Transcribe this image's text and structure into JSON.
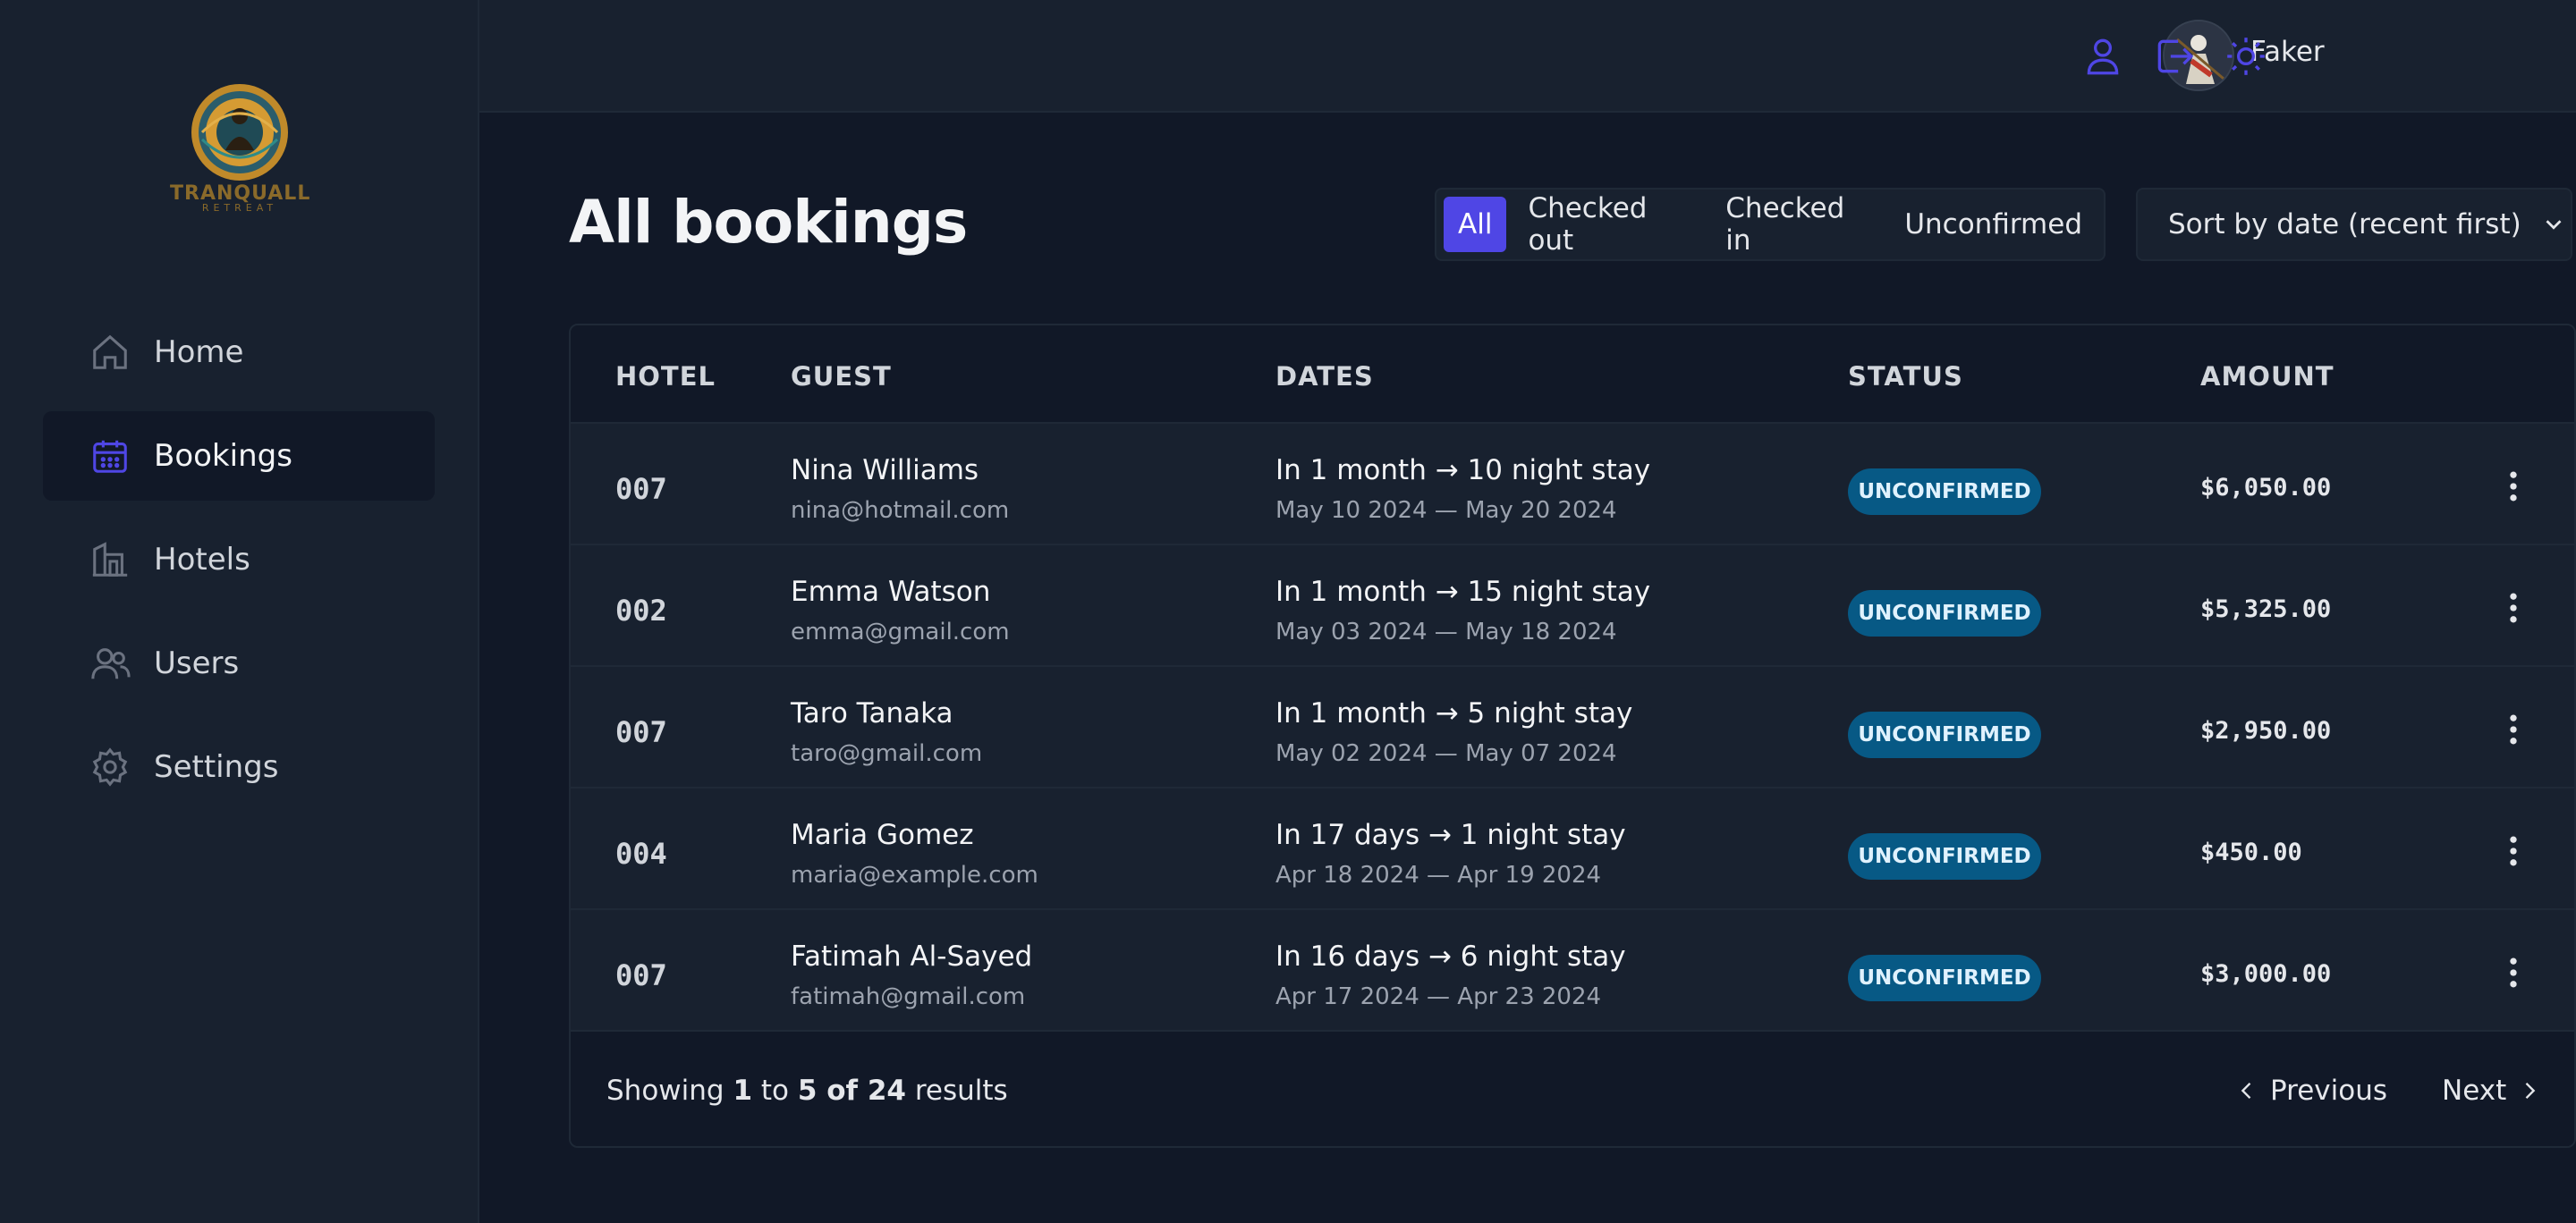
{
  "brand": {
    "name": "TRANQUALL",
    "tagline": "RETREAT"
  },
  "sidebar": {
    "items": [
      {
        "label": "Home",
        "icon": "home-icon",
        "active": false
      },
      {
        "label": "Bookings",
        "icon": "calendar-icon",
        "active": true
      },
      {
        "label": "Hotels",
        "icon": "building-icon",
        "active": false
      },
      {
        "label": "Users",
        "icon": "users-icon",
        "active": false
      },
      {
        "label": "Settings",
        "icon": "gear-icon",
        "active": false
      }
    ]
  },
  "header": {
    "username": "Faker",
    "actions": [
      "user-icon",
      "logout-icon",
      "sun-icon"
    ]
  },
  "page": {
    "title": "All bookings"
  },
  "filter": {
    "options": [
      "All",
      "Checked out",
      "Checked in",
      "Unconfirmed"
    ],
    "selected": "All"
  },
  "sort": {
    "selected": "Sort by date (recent first)"
  },
  "table": {
    "columns": [
      "HOTEL",
      "GUEST",
      "DATES",
      "STATUS",
      "AMOUNT"
    ],
    "rows": [
      {
        "hotel": "007",
        "guest": "Nina Williams",
        "email": "nina@hotmail.com",
        "dates": "In 1 month → 10 night stay",
        "range": "May 10 2024 — May 20 2024",
        "status": "UNCONFIRMED",
        "amount": "$6,050.00"
      },
      {
        "hotel": "002",
        "guest": "Emma Watson",
        "email": "emma@gmail.com",
        "dates": "In 1 month → 15 night stay",
        "range": "May 03 2024 — May 18 2024",
        "status": "UNCONFIRMED",
        "amount": "$5,325.00"
      },
      {
        "hotel": "007",
        "guest": "Taro Tanaka",
        "email": "taro@gmail.com",
        "dates": "In 1 month → 5 night stay",
        "range": "May 02 2024 — May 07 2024",
        "status": "UNCONFIRMED",
        "amount": "$2,950.00"
      },
      {
        "hotel": "004",
        "guest": "Maria Gomez",
        "email": "maria@example.com",
        "dates": "In 17 days → 1 night stay",
        "range": "Apr 18 2024 — Apr 19 2024",
        "status": "UNCONFIRMED",
        "amount": "$450.00"
      },
      {
        "hotel": "007",
        "guest": "Fatimah Al-Sayed",
        "email": "fatimah@gmail.com",
        "dates": "In 16 days → 6 night stay",
        "range": "Apr 17 2024 — Apr 23 2024",
        "status": "UNCONFIRMED",
        "amount": "$3,000.00"
      }
    ]
  },
  "footer": {
    "showing_prefix": "Showing",
    "from": "1",
    "to_word": "to",
    "to_and_total": "5 of 24",
    "suffix": "results",
    "previous": "Previous",
    "next": "Next"
  },
  "colors": {
    "accent": "#4f46e5",
    "badge_bg": "#075985",
    "background": "#111827",
    "surface": "#18212f"
  }
}
